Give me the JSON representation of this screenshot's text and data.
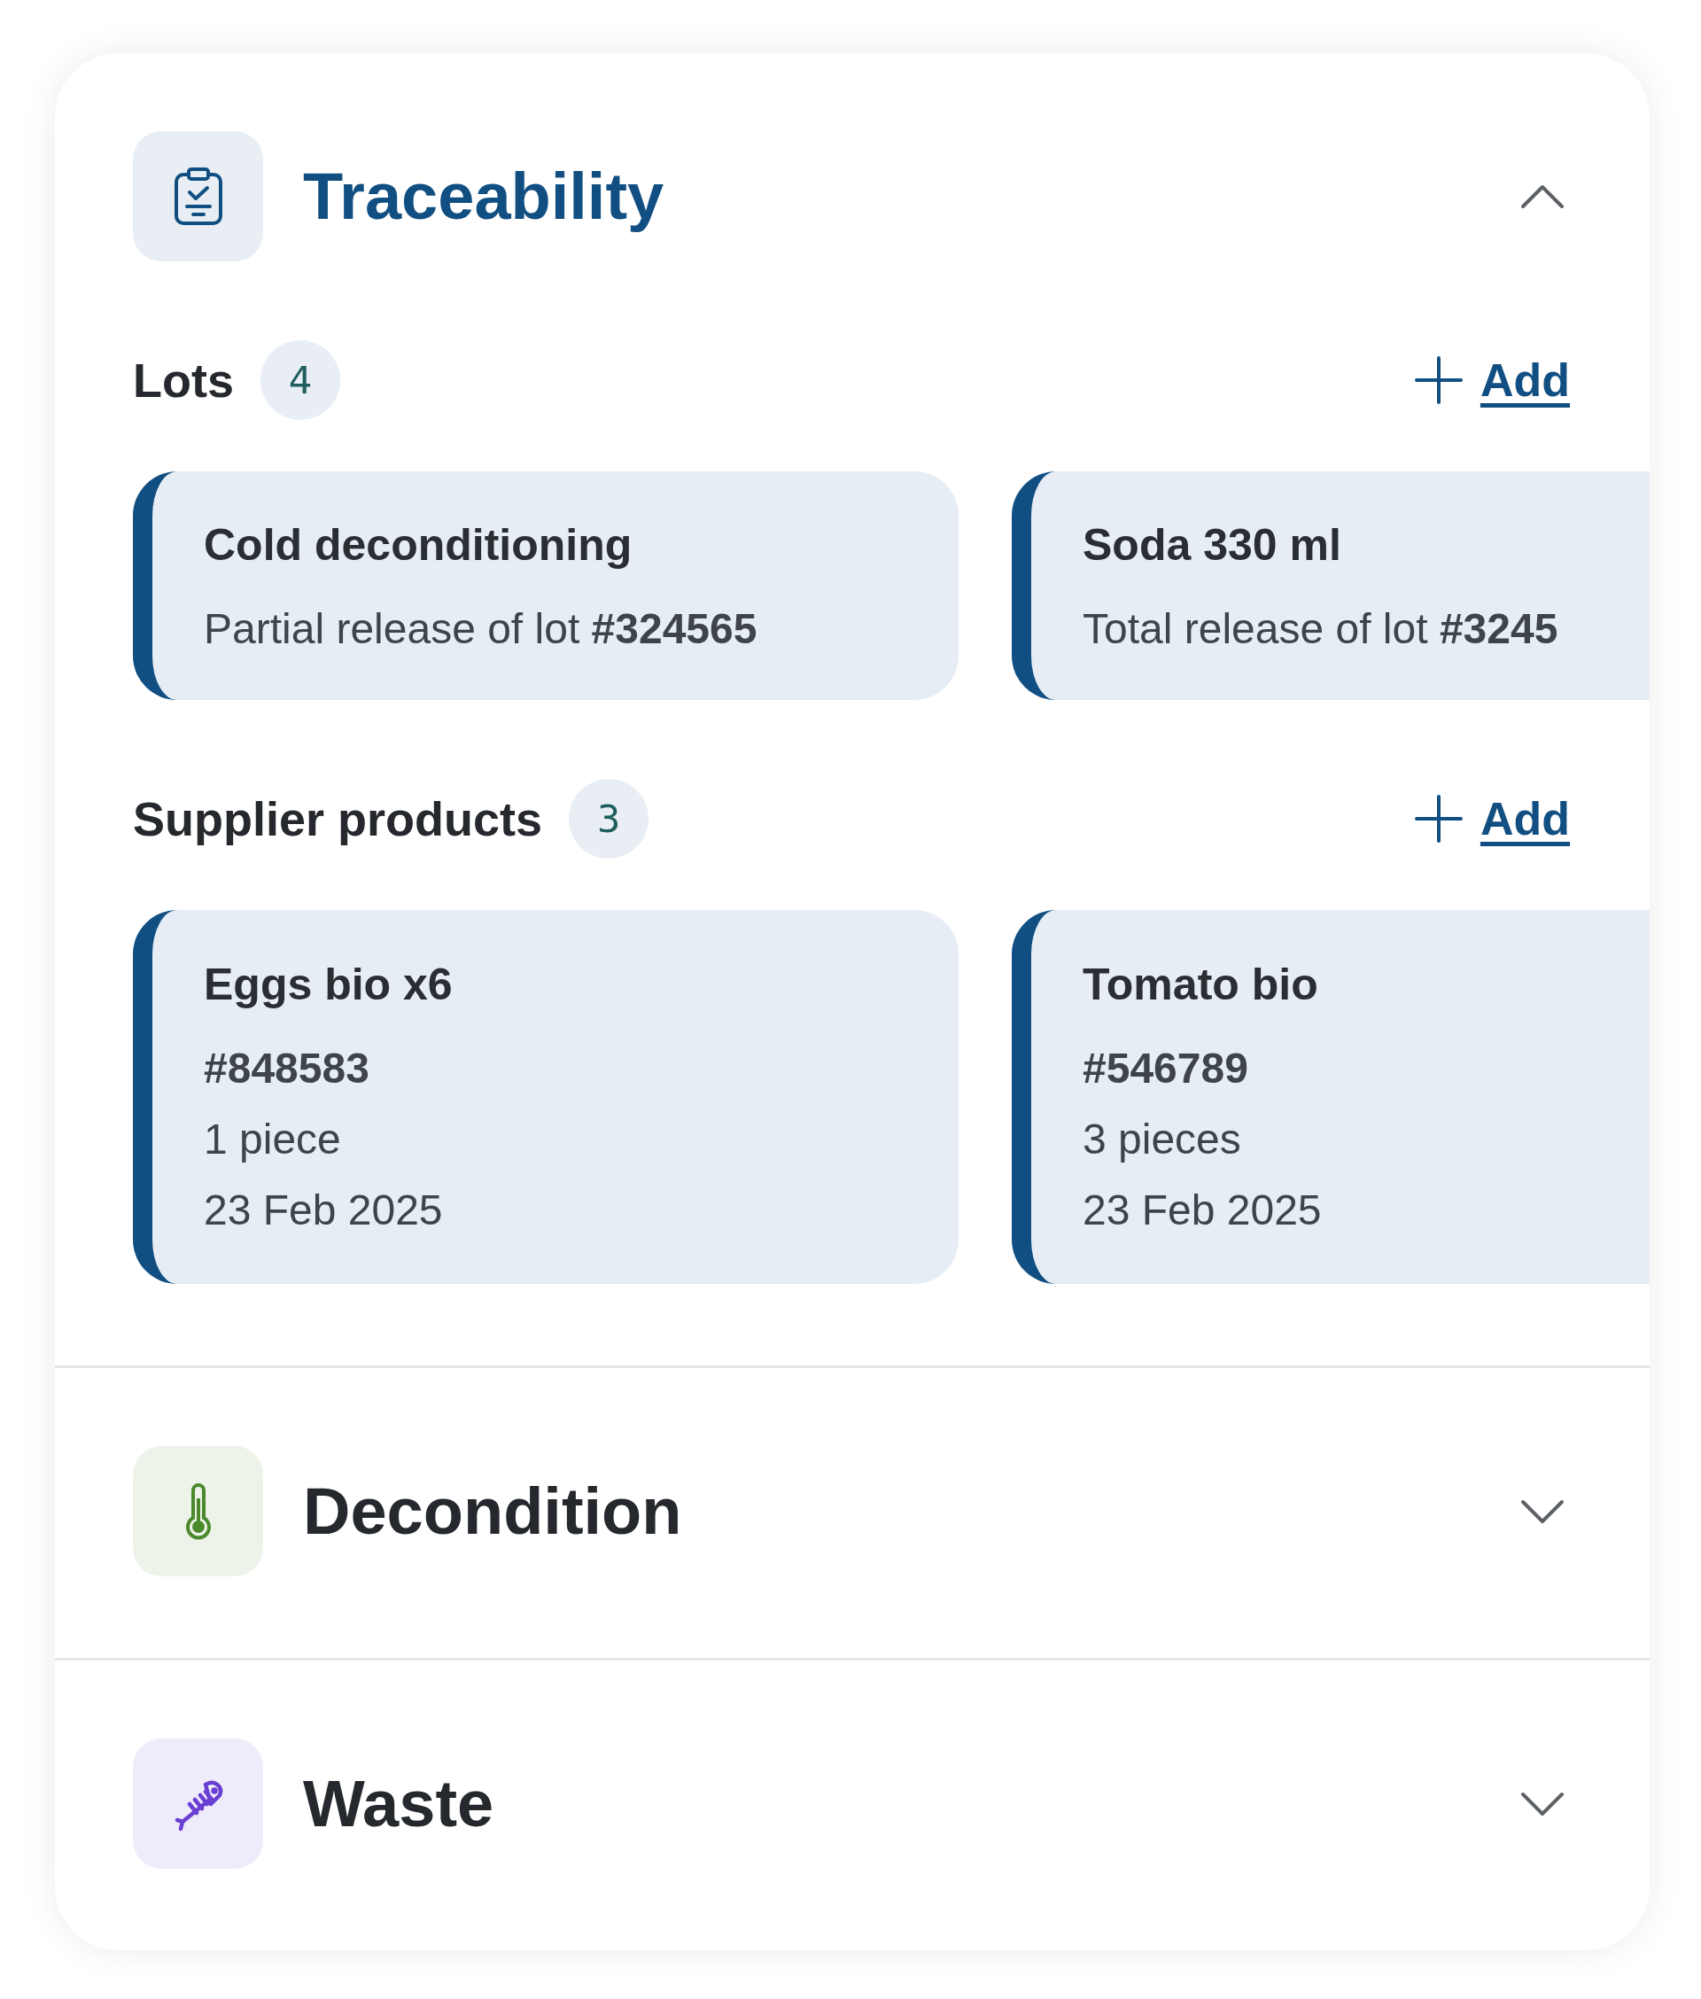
{
  "sections": [
    {
      "kind": "clipboard",
      "title": "Traceability",
      "expanded": true,
      "groups": [
        {
          "kind": "lots",
          "title": "Lots",
          "count": "4",
          "action": "Add",
          "items": [
            {
              "name": "Cold deconditioning",
              "detail": "Partial release of lot **#324565**"
            },
            {
              "name": "Soda 330 ml",
              "detail": "Total release of lot **#3245**"
            }
          ]
        },
        {
          "kind": "products",
          "title": "Supplier products",
          "count": "3",
          "action": "Add",
          "items": [
            {
              "name": "Eggs bio x6",
              "code": "#848583",
              "quantity": "1 piece",
              "date": "23 Feb 2025"
            },
            {
              "name": "Tomato bio",
              "code": "#546789",
              "quantity": "3 pieces",
              "date": "23 Feb 2025"
            }
          ]
        }
      ]
    },
    {
      "kind": "thermometer",
      "title": "Decondition",
      "expanded": false
    },
    {
      "kind": "fish",
      "title": "Waste",
      "expanded": false
    }
  ]
}
